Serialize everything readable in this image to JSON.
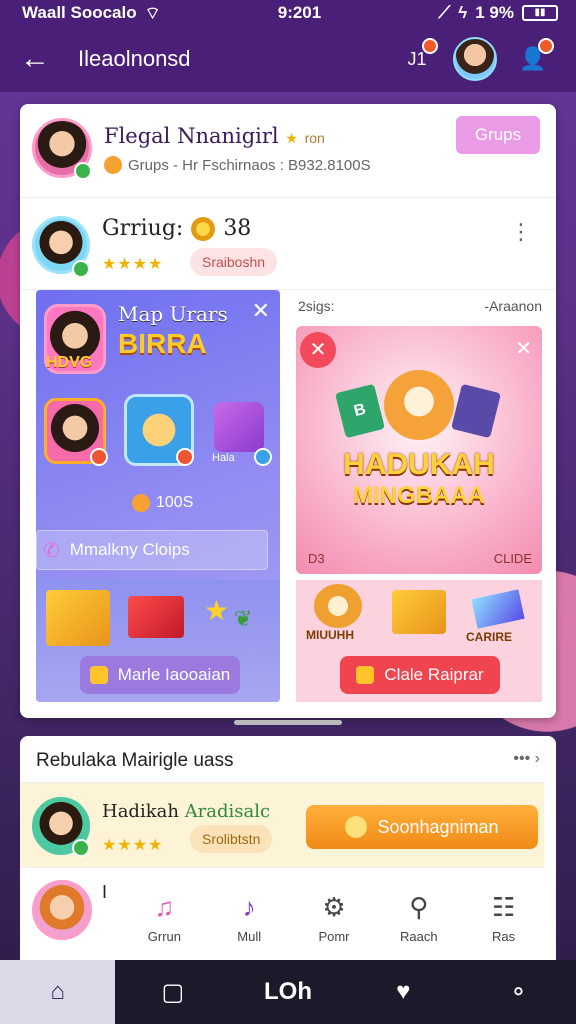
{
  "status_bar": {
    "carrier": "Waall Soocalo",
    "time": "9:201",
    "battery": "1 9%"
  },
  "app_bar": {
    "title": "Ileaolnonsd",
    "notification_count": "J1"
  },
  "card_main": {
    "user1": {
      "name": "Flegal Nnanigirl",
      "tag": "ron",
      "subtitle": "Grups - Hr Fschirnaos : B932.8100S",
      "button": "Grups"
    },
    "user2": {
      "name": "Grriug:",
      "coins": "38",
      "pill": "Sraiboshn"
    },
    "panel_left": {
      "title1": "Map Urars",
      "title2": "BIRRA",
      "hdvg": "HDVG",
      "tile_label": "Hala",
      "amount": "100S",
      "search_label": "Mmalkny Cloips",
      "cta": "Marle Iaooaian"
    },
    "panel_right": {
      "label_left": "2sigs:",
      "label_right": "-Araanon",
      "promo_line1": "HADUKAH",
      "promo_line2": "MINGBAAA",
      "promo_card": "B",
      "corner_left": "D3",
      "corner_right": "CLIDE",
      "item1": "MIUUHH",
      "item3": "CARIRE",
      "cta": "Clale Raiprar"
    }
  },
  "card_second": {
    "section_title": "Rebulaka Mairigle uass",
    "section_more": "•••",
    "invite": {
      "name": "Hadikah",
      "name_accent": "Aradisalc",
      "pill": "Srolibtstn",
      "button": "Soonhagniman"
    },
    "row4_letter": "I",
    "menu": [
      {
        "icon": "♫",
        "label": "Grrun"
      },
      {
        "icon": "♪",
        "label": "Mull"
      },
      {
        "icon": "⚙",
        "label": "Pomr"
      },
      {
        "icon": "⚲",
        "label": "Raach"
      },
      {
        "icon": "☷",
        "label": "Ras"
      }
    ]
  },
  "bottom_nav": {
    "center_label": "LOh"
  },
  "colors": {
    "primary": "#4a1f78",
    "accent": "#f08a16",
    "pink": "#e99be6"
  }
}
